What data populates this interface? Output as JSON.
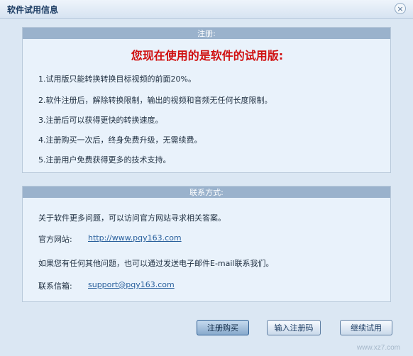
{
  "window": {
    "title": "软件试用信息",
    "close_glyph": "×"
  },
  "register_panel": {
    "header": "注册:",
    "headline": "您现在使用的是软件的试用版:",
    "items": [
      "1.试用版只能转换转换目标视频的前面20%。",
      "2.软件注册后，解除转换限制，输出的视频和音频无任何长度限制。",
      "3.注册后可以获得更快的转换速度。",
      "4.注册购买一次后，终身免费升级，无需续费。",
      "5.注册用户免费获得更多的技术支持。"
    ]
  },
  "contact_panel": {
    "header": "联系方式:",
    "lines": {
      "about": "关于软件更多问题，可以访问官方网站寻求相关答案。",
      "website_label": "官方网站:",
      "website_url": "http://www.pqy163.com",
      "other": "如果您有任何其他问题，也可以通过发送电子邮件E-mail联系我们。",
      "email_label": "联系信箱:",
      "email": "support@pqy163.com"
    }
  },
  "buttons": {
    "buy": "注册购买",
    "enter_code": "输入注册码",
    "continue_trial": "继续试用"
  },
  "watermark": "www.xz7.com"
}
